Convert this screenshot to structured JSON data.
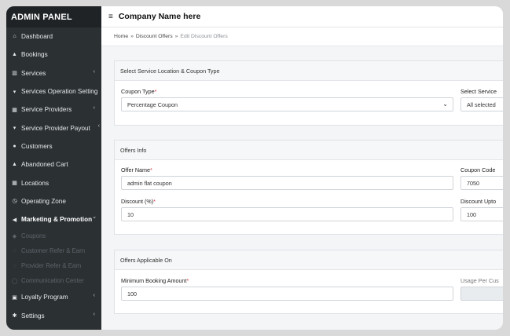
{
  "sidebar": {
    "brand": "ADMIN PANEL",
    "items": [
      {
        "label": "Dashboard",
        "icon": "dashboard-icon",
        "glyph": "⌂",
        "chevron": ""
      },
      {
        "label": "Bookings",
        "icon": "bookings-icon",
        "glyph": "▲",
        "chevron": ""
      },
      {
        "label": "Services",
        "icon": "services-icon",
        "glyph": "▥",
        "chevron": "‹"
      },
      {
        "label": "Services Operation Setting",
        "icon": "cart-icon",
        "glyph": "▾",
        "chevron": ""
      },
      {
        "label": "Service Providers",
        "icon": "grid-icon",
        "glyph": "▦",
        "chevron": "‹"
      },
      {
        "label": "Service Provider Payout",
        "icon": "cart-icon",
        "glyph": "▾",
        "chevron": "‹"
      },
      {
        "label": "Customers",
        "icon": "users-icon",
        "glyph": "●",
        "chevron": ""
      },
      {
        "label": "Abandoned Cart",
        "icon": "user-icon",
        "glyph": "▲",
        "chevron": ""
      },
      {
        "label": "Locations",
        "icon": "table-icon",
        "glyph": "▦",
        "chevron": ""
      },
      {
        "label": "Operating Zone",
        "icon": "clock-icon",
        "glyph": "◷",
        "chevron": ""
      },
      {
        "label": "Marketing & Promotion",
        "icon": "megaphone-icon",
        "glyph": "◀",
        "chevron": "⌄"
      }
    ],
    "subitems": [
      {
        "label": "Coupons",
        "icon": "coupon-icon",
        "glyph": "◆"
      },
      {
        "label": "Customer Refer & Earn",
        "icon": "thumbs-up-icon",
        "glyph": "◌"
      },
      {
        "label": "Provider Refer & Earn",
        "icon": "thumbs-up-icon",
        "glyph": "◌"
      },
      {
        "label": "Communication Center",
        "icon": "chat-icon",
        "glyph": "◯"
      }
    ],
    "bottom_items": [
      {
        "label": "Loyalty Program",
        "icon": "loyalty-icon",
        "glyph": "▣",
        "chevron": "‹"
      },
      {
        "label": "Settings",
        "icon": "gear-icon",
        "glyph": "✱",
        "chevron": "‹"
      }
    ]
  },
  "topbar": {
    "menu_icon": "≡",
    "company_name": "Company Name here"
  },
  "breadcrumb": {
    "home": "Home",
    "section": "Discount Offers",
    "current": "Edit Discount Offers",
    "separator": "»"
  },
  "card1": {
    "header": "Select Service Location & Coupon Type",
    "coupon_type_label": "Coupon Type",
    "coupon_type_value": "Percentage Coupon",
    "select_service_label": "Select Service",
    "select_service_value": "All selected"
  },
  "card2": {
    "header": "Offers Info",
    "offer_name_label": "Offer Name",
    "offer_name_value": "admin flat coupon",
    "coupon_code_label": "Coupon Code",
    "coupon_code_value": "7050",
    "discount_label": "Discount (%)",
    "discount_value": "10",
    "discount_upto_label": "Discount Upto",
    "discount_upto_value": "100"
  },
  "card3": {
    "header": "Offers Applicable On",
    "min_booking_label": "Minimum Booking Amount",
    "min_booking_value": "100",
    "usage_label": "Usage Per Cus",
    "usage_value": ""
  },
  "required_mark": "*",
  "caret_glyph": "⌄",
  "colors": {
    "sidebar": "#2b3033",
    "brand_bg": "#1f2326",
    "required": "#d9363e"
  }
}
